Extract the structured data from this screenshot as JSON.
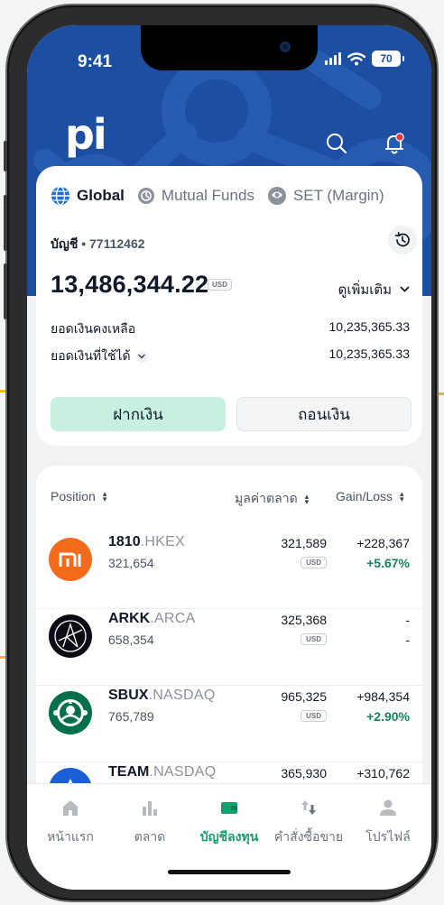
{
  "status_bar": {
    "time": "9:41",
    "battery": "70"
  },
  "header": {
    "logo": "pi",
    "search_icon": "search-icon",
    "bell_icon": "bell-icon",
    "bell_badge_color": "#e33b3b"
  },
  "tabs": [
    {
      "label": "Global",
      "icon": "globe-icon",
      "active": true
    },
    {
      "label": "Mutual Funds",
      "icon": "fund-icon",
      "active": false
    },
    {
      "label": "SET (Margin)",
      "icon": "set-icon",
      "active": false
    }
  ],
  "account": {
    "label": "บัญชี",
    "separator": "•",
    "number": "77112462"
  },
  "balance": {
    "value": "13,486,344.22",
    "currency": "USD",
    "see_more": "ดูเพิ่มเติม"
  },
  "summary": {
    "cash_label": "ยอดเงินคงเหลือ",
    "cash_value": "10,235,365.33",
    "available_label": "ยอดเงินที่ใช้ได้",
    "available_value": "10,235,365.33"
  },
  "actions": {
    "deposit": "ฝากเงิน",
    "withdraw": "ถอนเงิน"
  },
  "columns": {
    "position": "Position",
    "market_value": "มูลค่าตลาด",
    "gain_loss": "Gain/Loss"
  },
  "positions": [
    {
      "symbol": "1810",
      "market": ".HKEX",
      "qty": "321,654",
      "value": "321,589",
      "currency": "USD",
      "gain": "+228,367",
      "pct": "+5.67%"
    },
    {
      "symbol": "ARKK",
      "market": ".ARCA",
      "qty": "658,354",
      "value": "325,368",
      "currency": "USD",
      "gain": "-",
      "pct": "-"
    },
    {
      "symbol": "SBUX",
      "market": ".NASDAQ",
      "qty": "765,789",
      "value": "965,325",
      "currency": "USD",
      "gain": "+984,354",
      "pct": "+2.90%"
    },
    {
      "symbol": "TEAM",
      "market": ".NASDAQ",
      "qty": "",
      "value": "365,930",
      "currency": "",
      "gain": "+310,762",
      "pct": ""
    }
  ],
  "nav": [
    {
      "label": "หน้าแรก",
      "icon": "home-icon"
    },
    {
      "label": "ตลาด",
      "icon": "market-icon"
    },
    {
      "label": "บัญชีลงทุน",
      "icon": "wallet-icon",
      "active": true
    },
    {
      "label": "คำสั่งซื้อขาย",
      "icon": "orders-icon"
    },
    {
      "label": "โปรไฟล์",
      "icon": "profile-icon"
    }
  ],
  "colors": {
    "header_blue": "#1c4fa1",
    "accent_green": "#15a06b",
    "deposit_bg": "#c8f0e1",
    "annotation": "#f0b323"
  }
}
